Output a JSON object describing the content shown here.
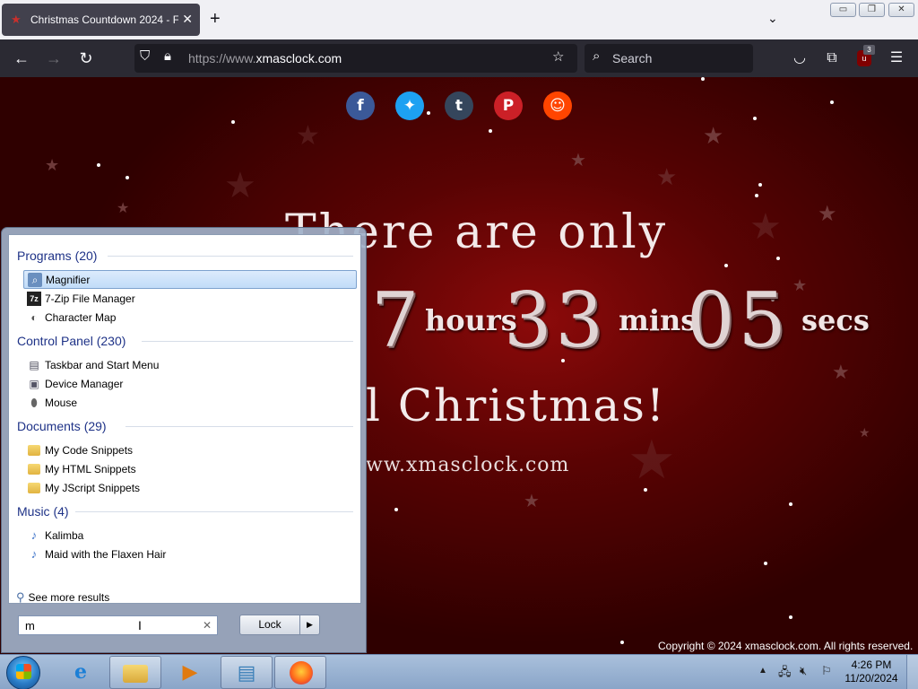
{
  "browser": {
    "tab_title": "Christmas Countdown 2024 - F",
    "url_scheme": "https://www.",
    "url_host": "xmasclock.com",
    "search_placeholder": "Search",
    "extension_badge": "3"
  },
  "page": {
    "headline": "There are only",
    "countdown": {
      "hours": "7",
      "hours_label": "hours",
      "mins": "33",
      "mins_label": "mins",
      "secs": "05",
      "secs_label": "secs"
    },
    "until": "l Christmas!",
    "site": "ww.xmasclock.com",
    "copyright": "Copyright © 2024 xmasclock.com. All rights reserved.",
    "social": [
      "facebook",
      "twitter",
      "tumblr",
      "pinterest",
      "reddit"
    ],
    "colors": {
      "facebook": "#3b5998",
      "twitter": "#1da1f2",
      "tumblr": "#35465c",
      "pinterest": "#cb2027",
      "reddit": "#ff4500"
    }
  },
  "start_menu": {
    "groups": [
      {
        "heading": "Programs (20)",
        "items": [
          "Magnifier",
          "7-Zip File Manager",
          "Character Map"
        ]
      },
      {
        "heading": "Control Panel (230)",
        "items": [
          "Taskbar and Start Menu",
          "Device Manager",
          "Mouse"
        ]
      },
      {
        "heading": "Documents (29)",
        "items": [
          "My Code Snippets",
          "My HTML Snippets",
          "My JScript Snippets"
        ]
      },
      {
        "heading": "Music (4)",
        "items": [
          "Kalimba",
          "Maid with the Flaxen Hair"
        ]
      }
    ],
    "see_more": "See more results",
    "search_value": "m",
    "lock_label": "Lock"
  },
  "taskbar": {
    "time": "4:26 PM",
    "date": "11/20/2024",
    "pinned": [
      "internet-explorer",
      "windows-explorer",
      "media-player",
      "notepad",
      "firefox"
    ]
  }
}
